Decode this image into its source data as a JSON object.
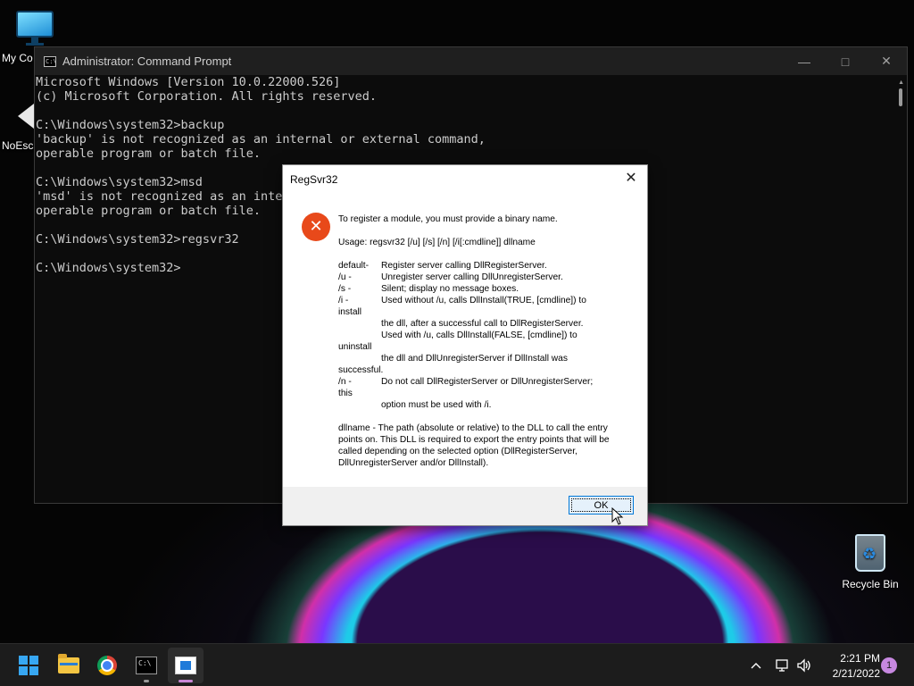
{
  "desktop": {
    "icons": [
      {
        "label": "My Co"
      },
      {
        "label": "NoEsca"
      },
      {
        "label": "Recycle Bin"
      }
    ]
  },
  "console": {
    "title": "Administrator: Command Prompt",
    "tb_icon_text": "C:\\",
    "lines": [
      "Microsoft Windows [Version 10.0.22000.526]",
      "(c) Microsoft Corporation. All rights reserved.",
      "",
      "C:\\Windows\\system32>backup",
      "'backup' is not recognized as an internal or external command,",
      "operable program or batch file.",
      "",
      "C:\\Windows\\system32>msd",
      "'msd' is not recognized as an inter",
      "operable program or batch file.",
      "",
      "C:\\Windows\\system32>regsvr32",
      "",
      "C:\\Windows\\system32>"
    ]
  },
  "dialog": {
    "title": "RegSvr32",
    "close_glyph": "✕",
    "error_glyph": "✕",
    "intro": "To register a module, you must provide a binary name.",
    "usage": "Usage: regsvr32 [/u] [/s] [/n] [/i[:cmdline]] dllname",
    "options": [
      {
        "key": "default-",
        "value": "Register server calling DllRegisterServer."
      },
      {
        "key": "/u -",
        "value": "Unregister server calling DllUnregisterServer."
      },
      {
        "key": "/s -",
        "value": "Silent; display no message boxes."
      },
      {
        "key": "/i -",
        "value": "Used without /u, calls DllInstall(TRUE, [cmdline]) to"
      }
    ],
    "wrap_install1": "install",
    "cont_1": "the dll, after a successful call to DllRegisterServer.",
    "cont_2": "Used with /u, calls DllInstall(FALSE, [cmdline]) to",
    "wrap_uninstall": "uninstall",
    "cont_3": "the dll and DllUnregisterServer if DllInstall was",
    "wrap_successful": "successful.",
    "opt_n_key": "/n -",
    "opt_n_value": "Do not call DllRegisterServer or DllUnregisterServer;",
    "wrap_this": "this",
    "cont_4": "option must be used with /i.",
    "dllname": "dllname - The path (absolute or relative) to the DLL to call the entry points on. This DLL is required to export the entry points that will be called depending on the selected option (DllRegisterServer, DllUnregisterServer and/or DllInstall).",
    "ok_label": "OK"
  },
  "taskbar": {
    "apps": [
      {
        "name": "start",
        "icon": "windows-logo-icon"
      },
      {
        "name": "file-explorer",
        "icon": "folder-icon"
      },
      {
        "name": "chrome",
        "icon": "chrome-icon"
      },
      {
        "name": "command-prompt",
        "icon": "terminal-icon"
      },
      {
        "name": "regsvr32",
        "icon": "window-app-icon"
      }
    ],
    "tray": {
      "chevron": "^",
      "time": "2:21 PM",
      "date": "2/21/2022",
      "notification_count": "1"
    }
  },
  "colors": {
    "console_bg": "#0c0c0c",
    "console_text": "#cccccc",
    "error_red": "#e8491a",
    "accent_blue": "#0078d7",
    "taskbar_bg": "#1c1c1c"
  }
}
